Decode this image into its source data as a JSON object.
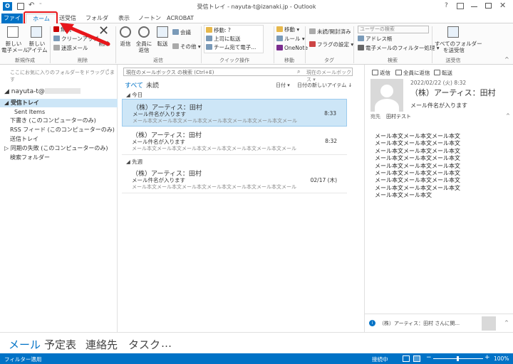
{
  "window": {
    "title": "受信トレイ - nayuta-t@izanaki.jp - Outlook",
    "help": "?",
    "app_badge": "O"
  },
  "tabs": [
    "ファイル",
    "ホーム",
    "送受信",
    "フォルダー",
    "表示",
    "ノートン",
    "ACROBAT"
  ],
  "ribbon": {
    "new_mail": "新しい\n電子メール",
    "new_items": "新しい\nアイテム",
    "ignore": "無視",
    "cleanup": "クリーンアップ",
    "junk": "迷惑メール",
    "delete": "削除",
    "reply": "返信",
    "reply_all": "全員に\n返信",
    "forward": "転送",
    "meeting": "会議",
    "more": "その他",
    "qs_move": "移動: ?",
    "qs_reply_delete": "上司に転送",
    "qs_team": "チーム宛て電子...",
    "move": "移動",
    "rules": "ルール",
    "onenote": "OneNote",
    "unread": "未読/開封済み",
    "followup": "フラグの設定",
    "search_people_placeholder": "ユーザーの検索",
    "address_book": "アドレス帳",
    "filter_email": "電子メールのフィルター処理",
    "send_receive_all": "すべてのフォルダー\nを送受信",
    "groups": [
      "新規作成",
      "削除",
      "返信",
      "クイック操作",
      "移動",
      "タグ",
      "検索",
      "送受信"
    ]
  },
  "leftpane": {
    "favorites_hint": "ここにお気に入りのフォルダーをドラッグします",
    "account": "nayuta-t@",
    "folders": [
      "受信トレイ",
      "Sent Items",
      "下書き (このコンピューターのみ)",
      "RSS フィード (このコンピューターのみ)",
      "送信トレイ",
      "同期の失敗 (このコンピューターのみ)",
      "検索フォルダー"
    ]
  },
  "midpane": {
    "search_placeholder": "現在のメールボックス の検索 (Ctrl+E)",
    "search_scope": "現在のメールボックス",
    "filter_all": "すべて",
    "filter_unread": "未読",
    "sort_by": "日付",
    "sort_order": "日付の新しいアイテム",
    "groups": [
      {
        "label": "今日",
        "mails": [
          {
            "from": "（株）アーティス：田村",
            "subject": "メール件名が入ります",
            "preview": "メール本文メール本文メール本文メール本文メール本文メール本文メール",
            "time": "8:33",
            "selected": true
          },
          {
            "from": "（株）アーティス：田村",
            "subject": "メール件名が入ります",
            "preview": "メール本文メール本文メール本文メール本文メール本文メール本文メール",
            "time": "8:32",
            "selected": false
          }
        ]
      },
      {
        "label": "先週",
        "mails": [
          {
            "from": "（株）アーティス：田村",
            "subject": "メール件名が入ります",
            "preview": "メール本文メール本文メール本文メール本文メール本文メール本文メール",
            "time": "02/17 (木)",
            "selected": false
          }
        ]
      }
    ]
  },
  "readpane": {
    "reply": "返信",
    "reply_all": "全員に返信",
    "forward": "転送",
    "date": "2022/02/22 (火) 8:32",
    "sender": "（株）アーティス：田村",
    "subject": "メール件名が入ります",
    "to_label": "宛先",
    "to": "田村テスト",
    "body": [
      "メール本文メール本文メール本文",
      "メール本文メール本文メール本文",
      "メール本文メール本文メール本文",
      "メール本文メール本文メール本文",
      "メール本文メール本文メール本文",
      "メール本文メール本文メール本文",
      "メール本文メール本文メール本文",
      "メール本文メール本文メール本文",
      "メール本文メール本文"
    ],
    "people_bar": "（株）アーティス：田村 さんに関..."
  },
  "bottomnav": [
    "メール",
    "予定表",
    "連絡先",
    "タスク",
    "…"
  ],
  "status": {
    "left": "フィルター適用",
    "connection": "接続中",
    "zoom": "100%"
  },
  "colors": {
    "accent": "#0072c6",
    "selected": "#cde6f7",
    "highlight": "#e8161b"
  }
}
